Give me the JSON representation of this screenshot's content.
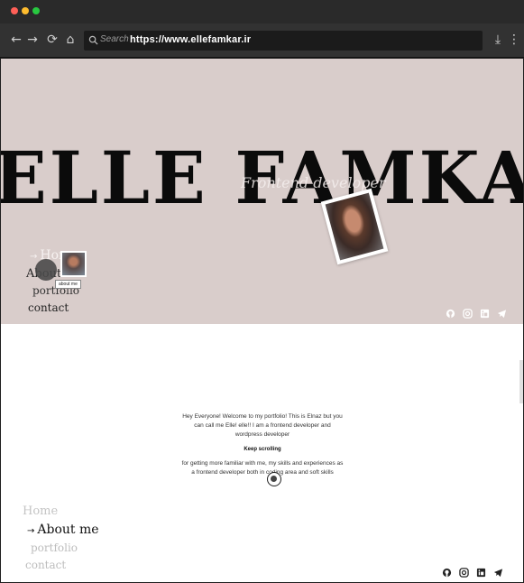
{
  "browser": {
    "search_label": "Search",
    "url": "https://www.ellefamkar.ir"
  },
  "hero": {
    "name": "ELLE FAMKAR",
    "role": "Frontend developer",
    "thumb_tooltip": "about me",
    "nav": {
      "arrow": "→",
      "home": "Home",
      "about": "About me",
      "portfolio": "portfolio",
      "contact": "contact"
    }
  },
  "about": {
    "intro": "Hey Everyone! Welcome to my portfolio! This is Elnaz but you can call me Elle! elle!! I am a frontend developer and wordpress developer",
    "keep_scrolling": "Keep scrolling",
    "details": "for getting more familiar with me, my skills and experiences as a frontend developer both in coding area and soft skills",
    "nav": {
      "arrow": "→",
      "home": "Home",
      "about": "About me",
      "portfolio": "portfolio",
      "contact": "contact"
    }
  },
  "social_icons": [
    "github-icon",
    "instagram-icon",
    "linkedin-icon",
    "telegram-icon"
  ],
  "colors": {
    "hero_bg": "#d9cdcb",
    "page_bg": "#ffffff",
    "text_dark": "#0b0b0b"
  }
}
